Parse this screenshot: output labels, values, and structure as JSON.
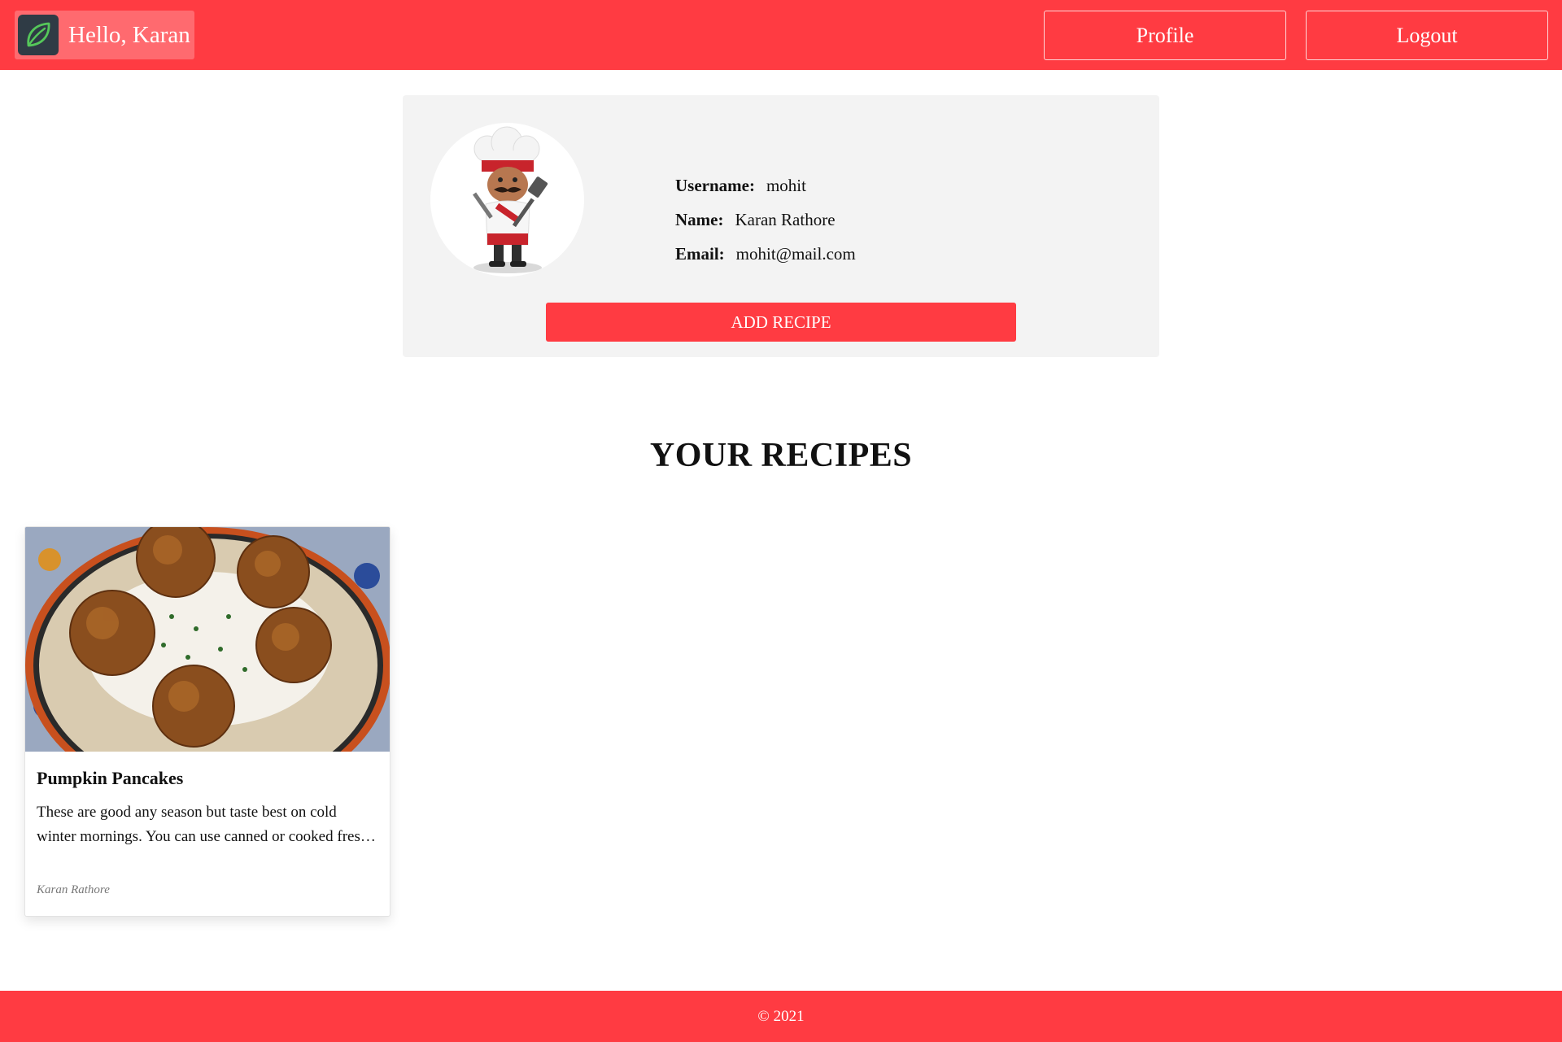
{
  "header": {
    "greeting": "Hello, Karan",
    "logo_icon": "leaf-icon",
    "profile_label": "Profile",
    "logout_label": "Logout"
  },
  "profile": {
    "avatar_icon": "chef-avatar",
    "fields": [
      {
        "label": "Username:",
        "value": "mohit"
      },
      {
        "label": "Name:",
        "value": "Karan Rathore"
      },
      {
        "label": "Email:",
        "value": "mohit@mail.com"
      }
    ],
    "add_recipe_label": "ADD RECIPE"
  },
  "recipes_section": {
    "title": "YOUR RECIPES",
    "recipes": [
      {
        "title": "Pumpkin Pancakes",
        "description": "These are good any season but taste best on cold winter mornings. You can use canned or cooked fres…",
        "author": "Karan Rathore",
        "image_icon": "falafel-plate-image"
      }
    ]
  },
  "footer": {
    "text": "© 2021"
  },
  "colors": {
    "brand": "#ff3b42",
    "card_bg": "#f3f3f3",
    "logo_bg": "#2f3b45",
    "leaf": "#55c75a"
  }
}
